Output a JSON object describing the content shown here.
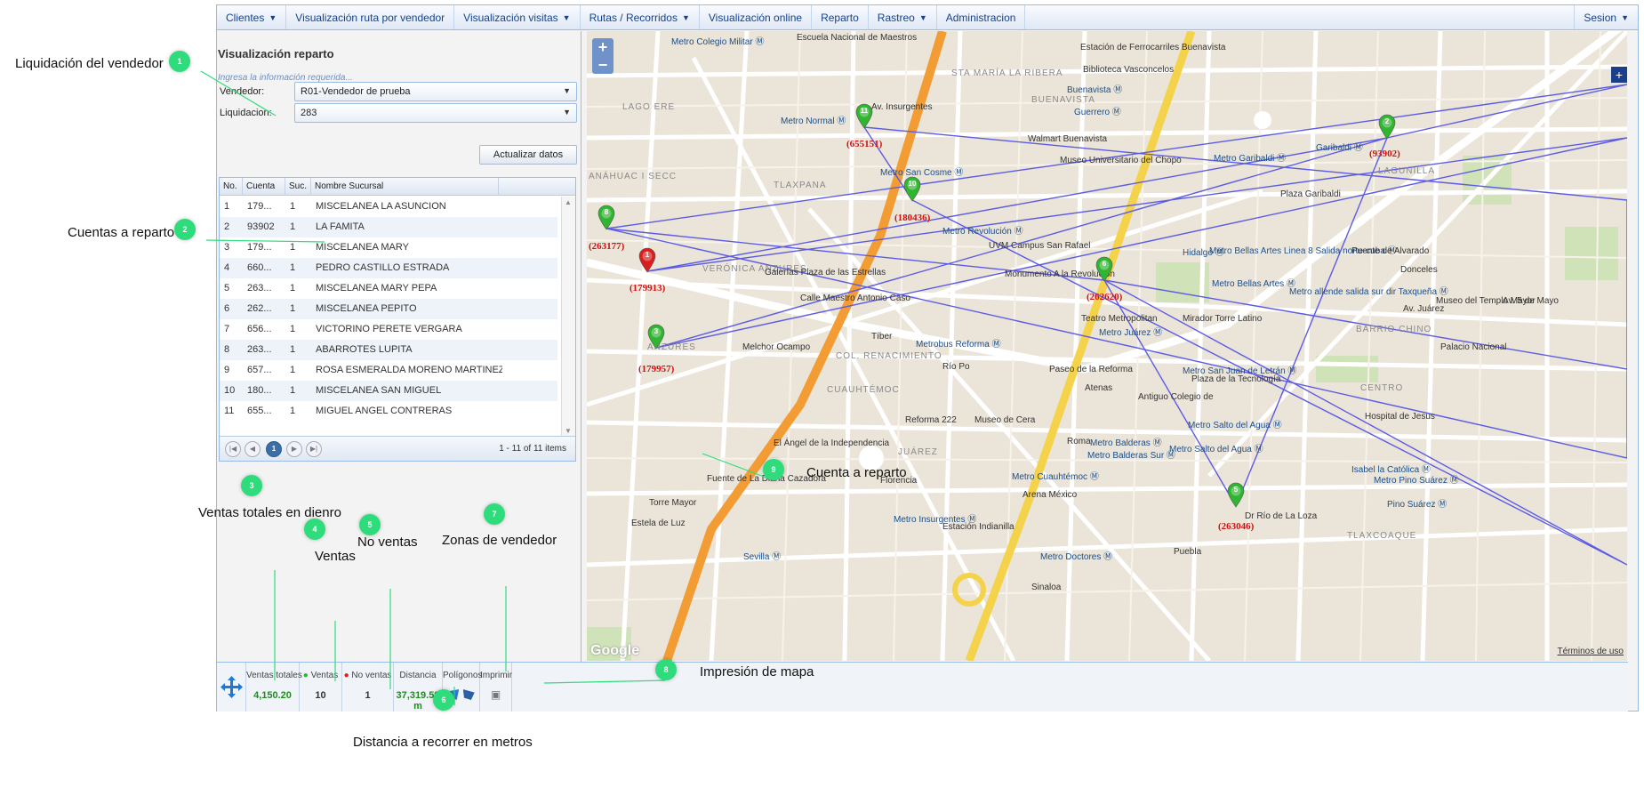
{
  "menu": {
    "items": [
      {
        "label": "Clientes",
        "dropdown": true
      },
      {
        "label": "Visualización ruta por vendedor",
        "dropdown": false
      },
      {
        "label": "Visualización visitas",
        "dropdown": true
      },
      {
        "label": "Rutas / Recorridos",
        "dropdown": true
      },
      {
        "label": "Visualización online",
        "dropdown": false
      },
      {
        "label": "Reparto",
        "dropdown": false
      },
      {
        "label": "Rastreo",
        "dropdown": true
      },
      {
        "label": "Administracion",
        "dropdown": false
      }
    ],
    "session": "Sesion"
  },
  "form": {
    "title": "Visualización reparto",
    "hint": "Ingresa la información requerida...",
    "vendedor_label": "Vendedor:",
    "vendedor_value": "R01-Vendedor de prueba",
    "liquidacion_label": "Liquidacion:",
    "liquidacion_value": "283",
    "update_button": "Actualizar datos"
  },
  "grid": {
    "columns": [
      "No.",
      "Cuenta",
      "Suc.",
      "Nombre Sucursal"
    ],
    "rows": [
      [
        "1",
        "179...",
        "1",
        "MISCELANEA LA ASUNCION"
      ],
      [
        "2",
        "93902",
        "1",
        "LA FAMITA"
      ],
      [
        "3",
        "179...",
        "1",
        "MISCELANEA MARY"
      ],
      [
        "4",
        "660...",
        "1",
        "PEDRO CASTILLO ESTRADA"
      ],
      [
        "5",
        "263...",
        "1",
        "MISCELANEA MARY PEPA"
      ],
      [
        "6",
        "262...",
        "1",
        "MISCELANEA PEPITO"
      ],
      [
        "7",
        "656...",
        "1",
        "VICTORINO PERETE VERGARA"
      ],
      [
        "8",
        "263...",
        "1",
        "ABARROTES LUPITA"
      ],
      [
        "9",
        "657...",
        "1",
        "ROSA ESMERALDA MORENO MARTINEZ"
      ],
      [
        "10",
        "180...",
        "1",
        "MISCELANEA SAN MIGUEL"
      ],
      [
        "11",
        "655...",
        "1",
        "MIGUEL ANGEL CONTRERAS"
      ]
    ],
    "page_current": "1",
    "page_info": "1 - 11 of 11 items"
  },
  "bottombar": {
    "ventas_totales_label": "Ventas totales",
    "ventas_totales_value": "4,150.20",
    "ventas_label": "Ventas",
    "ventas_value": "10",
    "no_ventas_label": "No ventas",
    "no_ventas_value": "1",
    "distancia_label": "Distancia",
    "distancia_value": "37,319.59 m",
    "poligonos_label": "Polígonos",
    "imprimir_label": "Imprimir"
  },
  "map": {
    "google_logo": "Google",
    "terms": "Términos de uso",
    "route_color": "#5b5be6",
    "pins": [
      {
        "num": "1",
        "id": "(179913)",
        "color": "#d81e1e"
      },
      {
        "num": "2",
        "id": "(93902)",
        "color": "#2fb52f"
      },
      {
        "num": "3",
        "id": "(179957)",
        "color": "#2fb52f"
      },
      {
        "num": "5",
        "id": "(263046)",
        "color": "#2fb52f"
      },
      {
        "num": "6",
        "id": "(262620)",
        "color": "#2fb52f"
      },
      {
        "num": "8",
        "id": "(263177)",
        "color": "#2fb52f"
      },
      {
        "num": "10",
        "id": "(180436)",
        "color": "#2fb52f"
      },
      {
        "num": "11",
        "id": "(655151)",
        "color": "#2fb52f"
      }
    ],
    "labels": [
      {
        "t": "Metro Colegio Militar",
        "k": "metro"
      },
      {
        "t": "Escuela Nacional de Maestros",
        "k": ""
      },
      {
        "t": "Estación de Ferrocarriles Buenavista",
        "k": ""
      },
      {
        "t": "Biblioteca Vasconcelos",
        "k": ""
      },
      {
        "t": "Buenavista",
        "k": "metro"
      },
      {
        "t": "STA MARÍA LA RIBERA",
        "k": "area"
      },
      {
        "t": "BUENAVISTA",
        "k": "area"
      },
      {
        "t": "Guerrero",
        "k": "metro"
      },
      {
        "t": "LAGO ERE",
        "k": "area"
      },
      {
        "t": "Metro Normal",
        "k": "metro"
      },
      {
        "t": "Walmart Buenavista",
        "k": ""
      },
      {
        "t": "Museo Universitario del Chopo",
        "k": ""
      },
      {
        "t": "Metro San Cosme",
        "k": "metro"
      },
      {
        "t": "Garibaldi",
        "k": "metro"
      },
      {
        "t": "Metro Garibaldi",
        "k": "metro"
      },
      {
        "t": "LAGUNILLA",
        "k": "area"
      },
      {
        "t": "Plaza Garibaldi",
        "k": ""
      },
      {
        "t": "ANÁHUAC I SECC",
        "k": "area"
      },
      {
        "t": "TLAXPANA",
        "k": "area"
      },
      {
        "t": "Metro Revolución",
        "k": "metro"
      },
      {
        "t": "UVM Campus San Rafael",
        "k": ""
      },
      {
        "t": "Hidalgo",
        "k": "metro"
      },
      {
        "t": "Metro Bellas Artes Linea 8 Salida norte-cuba",
        "k": "metro"
      },
      {
        "t": "Metro Bellas Artes",
        "k": "metro"
      },
      {
        "t": "VERÓNICA ANZURES",
        "k": "area"
      },
      {
        "t": "Galerías Plaza de las Estrellas",
        "k": ""
      },
      {
        "t": "Monumento A la Revolución",
        "k": ""
      },
      {
        "t": "Metro allende salida sur dir Taxqueña",
        "k": "metro"
      },
      {
        "t": "Museo del Templo Mayor",
        "k": ""
      },
      {
        "t": "Teatro Metropolitan",
        "k": ""
      },
      {
        "t": "Metro Juárez",
        "k": "metro"
      },
      {
        "t": "Mirador Torre Latino",
        "k": ""
      },
      {
        "t": "ANZURES",
        "k": "area"
      },
      {
        "t": "COL. RENACIMIENTO",
        "k": "area"
      },
      {
        "t": "Metrobus Reforma",
        "k": "metro"
      },
      {
        "t": "BARRIO CHINO",
        "k": "area"
      },
      {
        "t": "Palacio Nacional",
        "k": ""
      },
      {
        "t": "Metro San Juan de Letrán",
        "k": "metro"
      },
      {
        "t": "Plaza de la Tecnología",
        "k": ""
      },
      {
        "t": "CENTRO",
        "k": "area"
      },
      {
        "t": "CUAUHTÉMOC",
        "k": "area"
      },
      {
        "t": "Reforma 222",
        "k": ""
      },
      {
        "t": "Museo de Cera",
        "k": ""
      },
      {
        "t": "Metro Salto del Agua",
        "k": "metro"
      },
      {
        "t": "Hospital de Jesus",
        "k": ""
      },
      {
        "t": "El Ángel de la Independencia",
        "k": ""
      },
      {
        "t": "Metro Balderas",
        "k": "metro"
      },
      {
        "t": "Metro Salto del Agua",
        "k": "metro"
      },
      {
        "t": "JUÁREZ",
        "k": "area"
      },
      {
        "t": "Metro Balderas Sur",
        "k": "metro"
      },
      {
        "t": "Isabel la Católica",
        "k": "metro"
      },
      {
        "t": "Metro Pino Suárez",
        "k": "metro"
      },
      {
        "t": "Fuente de La Diana Cazadora",
        "k": ""
      },
      {
        "t": "Metro Cuauhtémoc",
        "k": "metro"
      },
      {
        "t": "Arena México",
        "k": ""
      },
      {
        "t": "Pino Suárez",
        "k": "metro"
      },
      {
        "t": "Torre Mayor",
        "k": ""
      },
      {
        "t": "Metro Insurgentes",
        "k": "metro"
      },
      {
        "t": "Estación Indianilla",
        "k": ""
      },
      {
        "t": "Estela de Luz",
        "k": ""
      },
      {
        "t": "Sevilla",
        "k": "metro"
      },
      {
        "t": "Metro Doctores",
        "k": "metro"
      },
      {
        "t": "TLAXCOAQUE",
        "k": "area"
      },
      {
        "t": "Paseo de la Reforma",
        "k": ""
      },
      {
        "t": "Av. Insurgentes",
        "k": ""
      },
      {
        "t": "Calle Maestro Antonio Caso",
        "k": ""
      },
      {
        "t": "Melchor Ocampo",
        "k": ""
      },
      {
        "t": "Puente de Alvarado",
        "k": ""
      },
      {
        "t": "Av. Juárez",
        "k": ""
      },
      {
        "t": "Av. 5 de Mayo",
        "k": ""
      },
      {
        "t": "Donceles",
        "k": ""
      },
      {
        "t": "Antiguo Colegio de",
        "k": ""
      },
      {
        "t": "Dr Río de La Loza",
        "k": ""
      },
      {
        "t": "Puebla",
        "k": ""
      },
      {
        "t": "Roma",
        "k": ""
      },
      {
        "t": "Atenas",
        "k": ""
      },
      {
        "t": "Florencia",
        "k": ""
      },
      {
        "t": "Río Po",
        "k": ""
      },
      {
        "t": "Tíber",
        "k": ""
      },
      {
        "t": "Sinaloa",
        "k": ""
      }
    ]
  },
  "annotations": [
    {
      "num": "1",
      "text": "Liquidación del vendedor"
    },
    {
      "num": "2",
      "text": "Cuentas a reparto"
    },
    {
      "num": "3",
      "text": "Ventas totales en dienro"
    },
    {
      "num": "4",
      "text": "Ventas"
    },
    {
      "num": "5",
      "text": "No ventas"
    },
    {
      "num": "6",
      "text": "Distancia a recorrer en metros"
    },
    {
      "num": "7",
      "text": "Zonas de vendedor"
    },
    {
      "num": "8",
      "text": "Impresión de mapa"
    },
    {
      "num": "9",
      "text": "Cuenta a reparto"
    }
  ]
}
